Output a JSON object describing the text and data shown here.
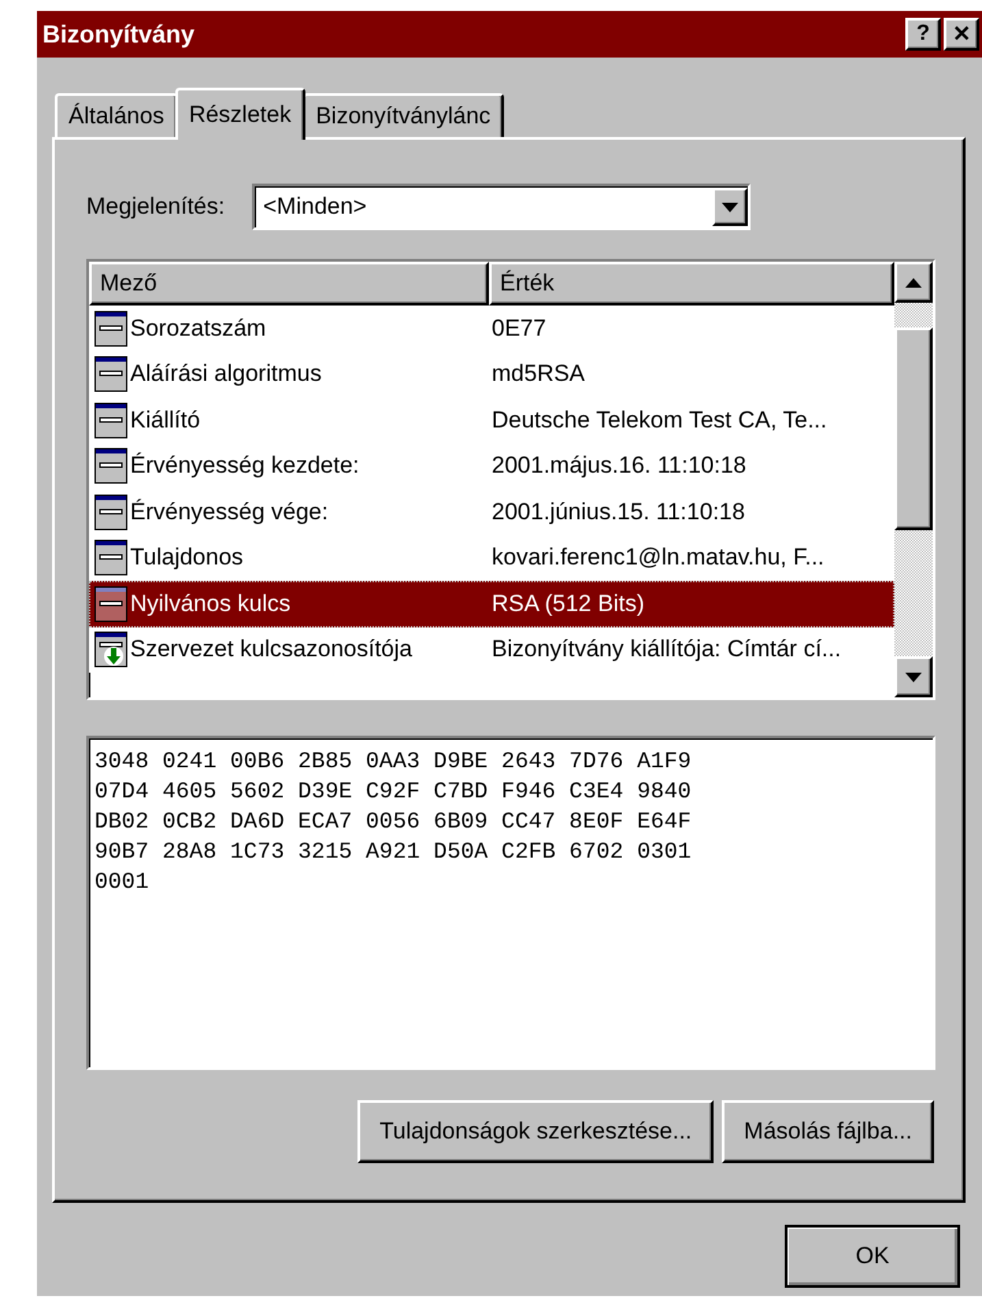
{
  "window": {
    "title": "Bizonyítvány",
    "help_button": "?",
    "close_button": "✕"
  },
  "tabs": [
    {
      "label": "Általános",
      "selected": false
    },
    {
      "label": "Részletek",
      "selected": true
    },
    {
      "label": "Bizonyítványlánc",
      "selected": false
    }
  ],
  "show": {
    "label": "Megjelenítés:",
    "value": "<Minden>"
  },
  "table": {
    "columns": [
      "Mező",
      "Érték"
    ],
    "rows": [
      {
        "kind": "field",
        "field": "Sorozatszám",
        "value": "0E77",
        "selected": false
      },
      {
        "kind": "field",
        "field": "Aláírási algoritmus",
        "value": "md5RSA",
        "selected": false
      },
      {
        "kind": "field",
        "field": "Kiállító",
        "value": "Deutsche Telekom Test CA, Te...",
        "selected": false
      },
      {
        "kind": "field",
        "field": "Érvényesség kezdete:",
        "value": "2001.május.16. 11:10:18",
        "selected": false
      },
      {
        "kind": "field",
        "field": "Érvényesség vége:",
        "value": "2001.június.15. 11:10:18",
        "selected": false
      },
      {
        "kind": "field",
        "field": "Tulajdonos",
        "value": "kovari.ferenc1@ln.matav.hu, F...",
        "selected": false
      },
      {
        "kind": "field",
        "field": "Nyilvános kulcs",
        "value": "RSA (512 Bits)",
        "selected": true
      },
      {
        "kind": "extension",
        "field": "Szervezet kulcsazonosítója",
        "value": "Bizonyítvány kiállítója: Címtár cí...",
        "selected": false
      }
    ]
  },
  "detail": {
    "lines": [
      "3048 0241 00B6 2B85 0AA3 D9BE 2643 7D76 A1F9",
      "07D4 4605 5602 D39E C92F C7BD F946 C3E4 9840",
      "DB02 0CB2 DA6D ECA7 0056 6B09 CC47 8E0F E64F",
      "90B7 28A8 1C73 3215 A921 D50A C2FB 6702 0301",
      "0001"
    ]
  },
  "buttons": [
    "Tulajdonságok szerkesztése...",
    "Másolás fájlba..."
  ],
  "ok_button": "OK"
}
